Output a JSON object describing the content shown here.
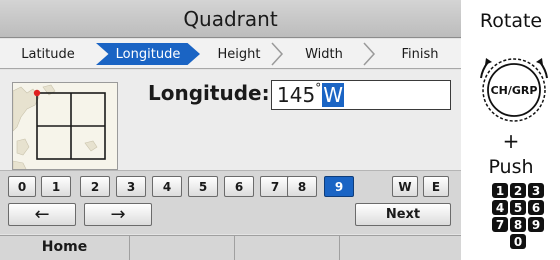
{
  "screen": {
    "title": "Quadrant",
    "wizard_steps": [
      {
        "label": "Latitude",
        "active": false
      },
      {
        "label": "Longitude",
        "active": true
      },
      {
        "label": "Height",
        "active": false
      },
      {
        "label": "Width",
        "active": false
      },
      {
        "label": "Finish",
        "active": false
      }
    ],
    "field": {
      "label": "Longitude:",
      "value_number": "145",
      "degree_symbol": "°",
      "value_cursor": "W"
    },
    "keypad": {
      "digits": [
        "0",
        "1",
        "2",
        "3",
        "4",
        "5",
        "6",
        "7",
        "8",
        "9"
      ],
      "selected_digit": "9",
      "west_label": "W",
      "east_label": "E",
      "back_arrow": "←",
      "forward_arrow": "→",
      "next_label": "Next"
    },
    "softkeys": [
      "Home",
      "",
      "",
      ""
    ]
  },
  "panel": {
    "rotate_label": "Rotate",
    "knob_label": "CH/GRP",
    "plus": "+",
    "push_label": "Push",
    "digit_keys": [
      "1",
      "2",
      "3",
      "4",
      "5",
      "6",
      "7",
      "8",
      "9",
      "0"
    ]
  },
  "colors": {
    "accent": "#1a64c4",
    "map_marker": "#e02020",
    "map_grid": "#1a1a1a"
  },
  "icons": {
    "knob": "rotary-knob-icon",
    "rotate_arrows": "rotate-arrows-icon"
  }
}
